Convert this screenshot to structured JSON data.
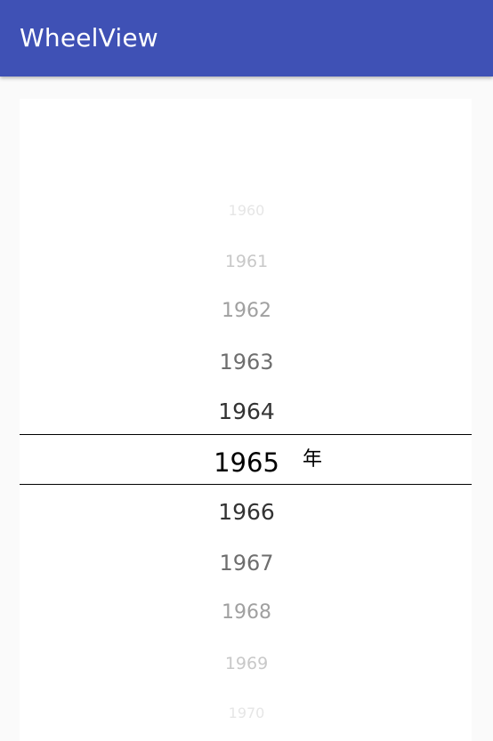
{
  "app_bar": {
    "title": "WheelView"
  },
  "wheel": {
    "items": [
      {
        "label": "1960",
        "color": "#e6e6e6"
      },
      {
        "label": "1961",
        "color": "#c8c8c8"
      },
      {
        "label": "1962",
        "color": "#a0a0a0"
      },
      {
        "label": "1963",
        "color": "#6e6e6e"
      },
      {
        "label": "1964",
        "color": "#333333"
      },
      {
        "label": "1965",
        "color": "#000000"
      },
      {
        "label": "1966",
        "color": "#333333"
      },
      {
        "label": "1967",
        "color": "#6e6e6e"
      },
      {
        "label": "1968",
        "color": "#a0a0a0"
      },
      {
        "label": "1969",
        "color": "#c8c8c8"
      },
      {
        "label": "1970",
        "color": "#e6e6e6"
      }
    ],
    "selected_value": "1965",
    "unit_label": "年"
  },
  "colors": {
    "primary": "#3f51b5",
    "background": "#fafafa",
    "card": "#ffffff"
  }
}
